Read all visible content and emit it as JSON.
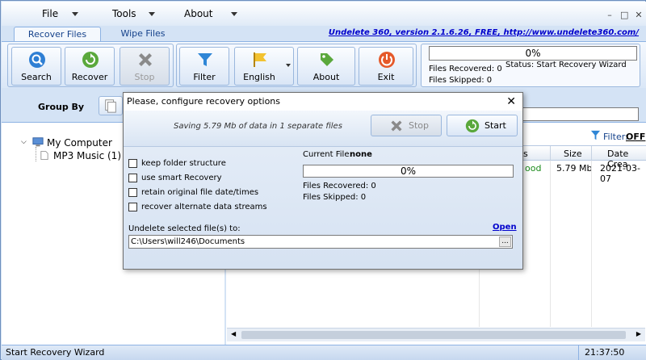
{
  "menu": {
    "file": "File",
    "tools": "Tools",
    "about": "About"
  },
  "tabs": [
    "Recover Files",
    "Wipe Files"
  ],
  "version_link": "Undelete 360, version 2.1.6.26, FREE, http://www.undelete360.com/",
  "toolbar": {
    "search": "Search",
    "recover": "Recover",
    "stop": "Stop",
    "filter": "Filter",
    "language": "English",
    "about": "About",
    "exit": "Exit"
  },
  "status_panel": {
    "progress": "0%",
    "files_recovered": "Files Recovered: 0",
    "files_skipped": "Files Skipped: 0",
    "status": "Status: Start Recovery Wizard",
    "progress_value": 0
  },
  "group_by": "Group By",
  "tree": {
    "root": "My Computer",
    "child": "MP3 Music (1)"
  },
  "filter_label": "Filter:",
  "filter_value": "OFF",
  "columns": {
    "state": "s",
    "size": "Size",
    "date": "Date Crea"
  },
  "row": {
    "state": "ood",
    "size": "5.79 Mb",
    "date": "2021-03-07"
  },
  "dialog": {
    "title": "Please, configure recovery options",
    "saving": "Saving 5.79 Mb of data in 1 separate files",
    "stop": "Stop",
    "start": "Start",
    "options": [
      "keep folder structure",
      "use smart Recovery",
      "retain original file date/times",
      "recover alternate data streams"
    ],
    "current_file_label": "Current File:",
    "current_file": "none",
    "progress": "0%",
    "progress_value": 0,
    "files_recovered": "Files Recovered: 0",
    "files_skipped": "Files Skipped: 0",
    "dest_label": "Undelete selected file(s) to:",
    "open": "Open",
    "dest_path": "C:\\Users\\will246\\Documents",
    "browse": "..."
  },
  "statusbar": {
    "text": "Start Recovery Wizard",
    "time": "21:37:50"
  }
}
